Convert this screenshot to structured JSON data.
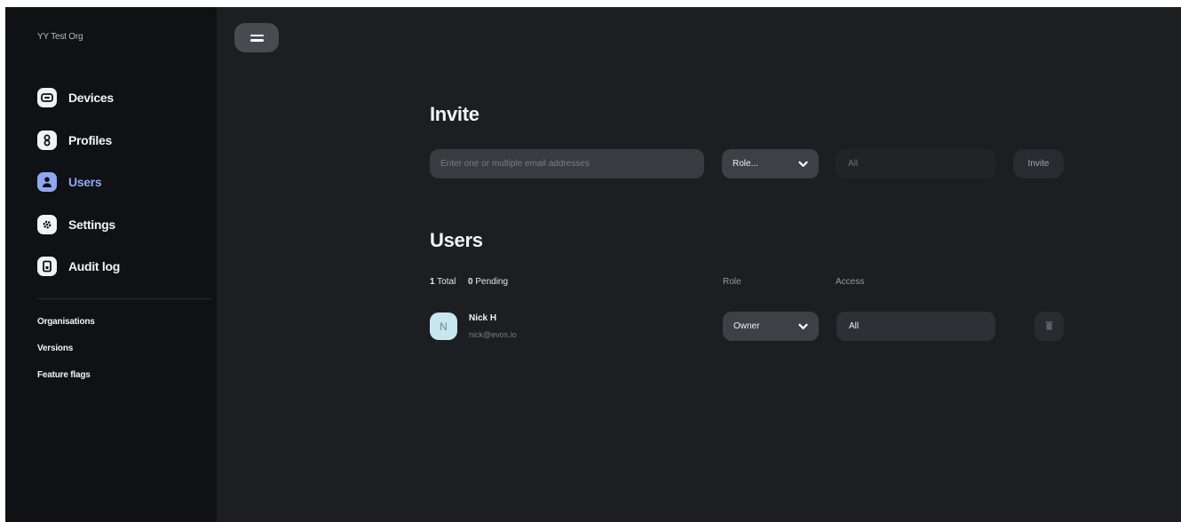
{
  "sidebar": {
    "org_name": "YY Test Org",
    "nav": [
      {
        "label": "Devices",
        "icon": "device-icon"
      },
      {
        "label": "Profiles",
        "icon": "profile-icon"
      },
      {
        "label": "Users",
        "icon": "user-icon"
      },
      {
        "label": "Settings",
        "icon": "gear-icon"
      },
      {
        "label": "Audit log",
        "icon": "audit-log-icon"
      }
    ],
    "active": "Users",
    "sub_nav": [
      "Organisations",
      "Versions",
      "Feature flags"
    ]
  },
  "topbar": {
    "menu_icon": "hamburger-icon"
  },
  "invite": {
    "title": "Invite",
    "email_placeholder": "Enter one or multiple email addresses",
    "role_select": "Role...",
    "access_value": "All",
    "button": "Invite"
  },
  "users": {
    "title": "Users",
    "total_count": "1",
    "total_label": "Total",
    "pending_count": "0",
    "pending_label": "Pending",
    "columns": {
      "role": "Role",
      "access": "Access"
    },
    "rows": [
      {
        "initial": "N",
        "name": "Nick H",
        "email": "nick@evos.io",
        "role": "Owner",
        "access": "All"
      }
    ]
  },
  "colors": {
    "background": "#1d1e22",
    "sidebar": "#101114",
    "accent": "#8fa8f0",
    "avatar_bg": "#c7e6ee"
  }
}
